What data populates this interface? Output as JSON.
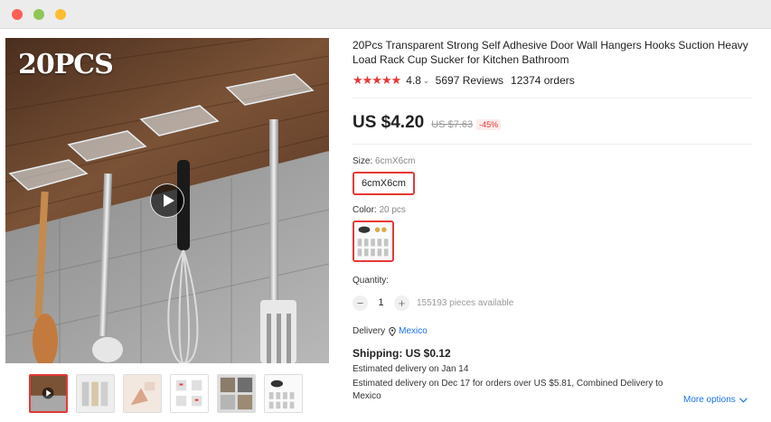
{
  "window": {
    "buttons": [
      "close",
      "minimize",
      "maximize"
    ]
  },
  "gallery": {
    "main_overlay_text": "20PCS",
    "video_play_icon": "play-icon",
    "thumbnails": [
      {
        "name": "thumb-video",
        "active": true
      },
      {
        "name": "thumb-2",
        "active": false
      },
      {
        "name": "thumb-3",
        "active": false
      },
      {
        "name": "thumb-4",
        "active": false
      },
      {
        "name": "thumb-5",
        "active": false
      },
      {
        "name": "thumb-6",
        "active": false
      }
    ]
  },
  "product": {
    "title": "20Pcs Transparent Strong Self Adhesive Door Wall Hangers Hooks Suction Heavy Load Rack Cup Sucker for Kitchen Bathroom",
    "stars": "★★★★★",
    "rating": "4.8",
    "reviews": "5697 Reviews",
    "orders": "12374 orders",
    "price": "US $4.20",
    "old_price": "US $7.63",
    "discount": "-45%"
  },
  "options": {
    "size_label": "Size:",
    "size_value": "6cmX6cm",
    "size_button": "6cmX6cm",
    "color_label": "Color:",
    "color_value": "20 pcs"
  },
  "quantity": {
    "label": "Quantity:",
    "minus": "−",
    "plus": "+",
    "value": "1",
    "available": "155193 pieces available"
  },
  "delivery": {
    "label": "Delivery",
    "country": "Mexico",
    "shipping": "Shipping: US $0.12",
    "estimate1": "Estimated delivery on Jan 14",
    "estimate2": "Estimated delivery on Dec 17 for orders over US $5.81, Combined Delivery to Mexico",
    "more_options": "More options"
  },
  "colors": {
    "accent": "#e53935",
    "link": "#1a73e8"
  }
}
